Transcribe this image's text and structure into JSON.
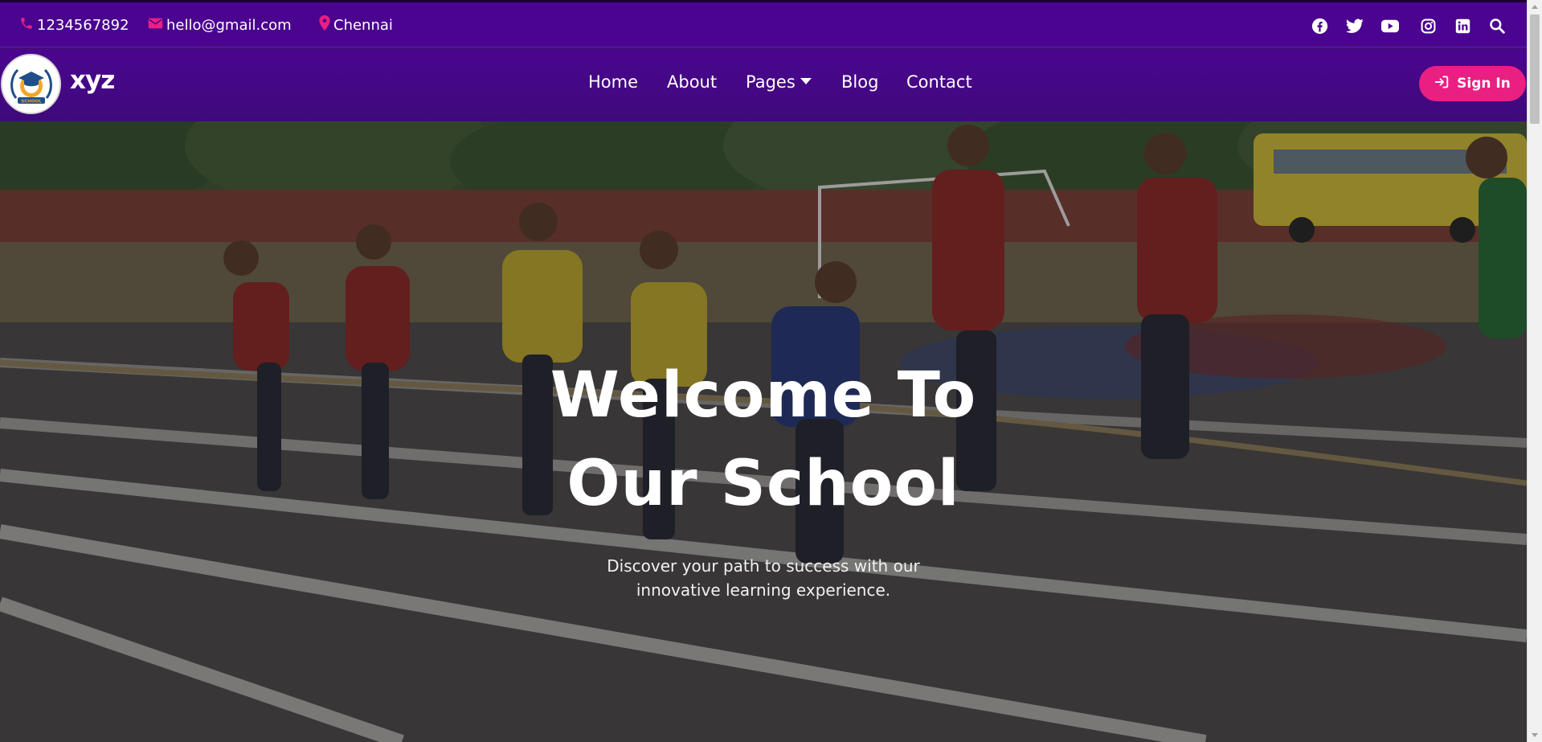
{
  "topbar": {
    "phone": "1234567892",
    "email": "hello@gmail.com",
    "location": "Chennai",
    "icon_color": "#ea1f82",
    "background": "#4a0490",
    "socials": [
      "facebook-icon",
      "twitter-icon",
      "youtube-icon",
      "instagram-icon",
      "linkedin-icon",
      "search-icon"
    ]
  },
  "navbar": {
    "brand": "xyz",
    "logo_text": "SCHOOL",
    "items": [
      {
        "label": "Home"
      },
      {
        "label": "About"
      },
      {
        "label": "Pages"
      },
      {
        "label": "Blog"
      },
      {
        "label": "Contact"
      }
    ],
    "signin_label": "Sign In",
    "signin_color": "#ea1f82"
  },
  "hero": {
    "title_line1": "Welcome To",
    "title_line2": "Our School",
    "subtitle": "Discover your path to success with our innovative learning experience."
  }
}
